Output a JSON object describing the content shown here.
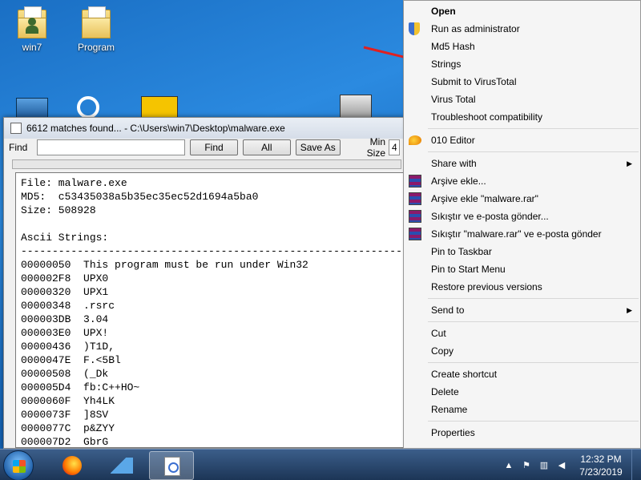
{
  "desktop": {
    "icons": [
      {
        "label": "win7"
      },
      {
        "label": "Program"
      }
    ]
  },
  "strings_window": {
    "title": "6612 matches found...  -  C:\\Users\\win7\\Desktop\\malware.exe",
    "find_label": "Find",
    "find_value": "",
    "find_button": "Find",
    "all_button": "All",
    "save_as_button": "Save As",
    "min_size_label": "Min Size",
    "min_size_value": "4",
    "output": "File: malware.exe\nMD5:  c53435038a5b35ec35ec52d1694a5ba0\nSize: 508928\n\nAscii Strings:\n---------------------------------------------------------------\n00000050  This program must be run under Win32\n000002F8  UPX0\n00000320  UPX1\n00000348  .rsrc\n000003DB  3.04\n000003E0  UPX!\n00000436  )T1D,\n0000047E  F.<5Bl\n00000508  (_Dk\n000005D4  fb:C++HO~\n0000060F  Yh4LK\n0000073F  ]8SV\n0000077C  p&ZYY\n000007D2  GbrG"
  },
  "context_menu": {
    "items": [
      {
        "label": "Open",
        "bold": true,
        "icon": ""
      },
      {
        "label": "Run as administrator",
        "icon": "shield-icon"
      },
      {
        "label": "Md5 Hash",
        "icon": ""
      },
      {
        "label": "Strings",
        "icon": ""
      },
      {
        "label": "Submit to VirusTotal",
        "icon": ""
      },
      {
        "label": "Virus Total",
        "icon": ""
      },
      {
        "label": "Troubleshoot compatibility",
        "icon": ""
      },
      {
        "sep": true
      },
      {
        "label": "010 Editor",
        "icon": "editor-icon"
      },
      {
        "sep": true
      },
      {
        "label": "Share with",
        "icon": "",
        "submenu": true
      },
      {
        "label": "Arşive ekle...",
        "icon": "winrar-icon"
      },
      {
        "label": "Arşive ekle \"malware.rar\"",
        "icon": "winrar-icon"
      },
      {
        "label": "Sıkıştır ve e-posta gönder...",
        "icon": "winrar-icon"
      },
      {
        "label": "Sıkıştır \"malware.rar\" ve e-posta gönder",
        "icon": "winrar-icon"
      },
      {
        "label": "Pin to Taskbar",
        "icon": ""
      },
      {
        "label": "Pin to Start Menu",
        "icon": ""
      },
      {
        "label": "Restore previous versions",
        "icon": ""
      },
      {
        "sep": true
      },
      {
        "label": "Send to",
        "icon": "",
        "submenu": true
      },
      {
        "sep": true
      },
      {
        "label": "Cut",
        "icon": ""
      },
      {
        "label": "Copy",
        "icon": ""
      },
      {
        "sep": true
      },
      {
        "label": "Create shortcut",
        "icon": ""
      },
      {
        "label": "Delete",
        "icon": ""
      },
      {
        "label": "Rename",
        "icon": ""
      },
      {
        "sep": true
      },
      {
        "label": "Properties",
        "icon": ""
      }
    ],
    "submenu_arrow": "▶"
  },
  "taskbar": {
    "clock_time": "12:32 PM",
    "clock_date": "7/23/2019",
    "tray_expand": "▲"
  },
  "colors": {
    "annotation_arrow": "#e02020",
    "desktop_blue": "#1a6fc4"
  }
}
